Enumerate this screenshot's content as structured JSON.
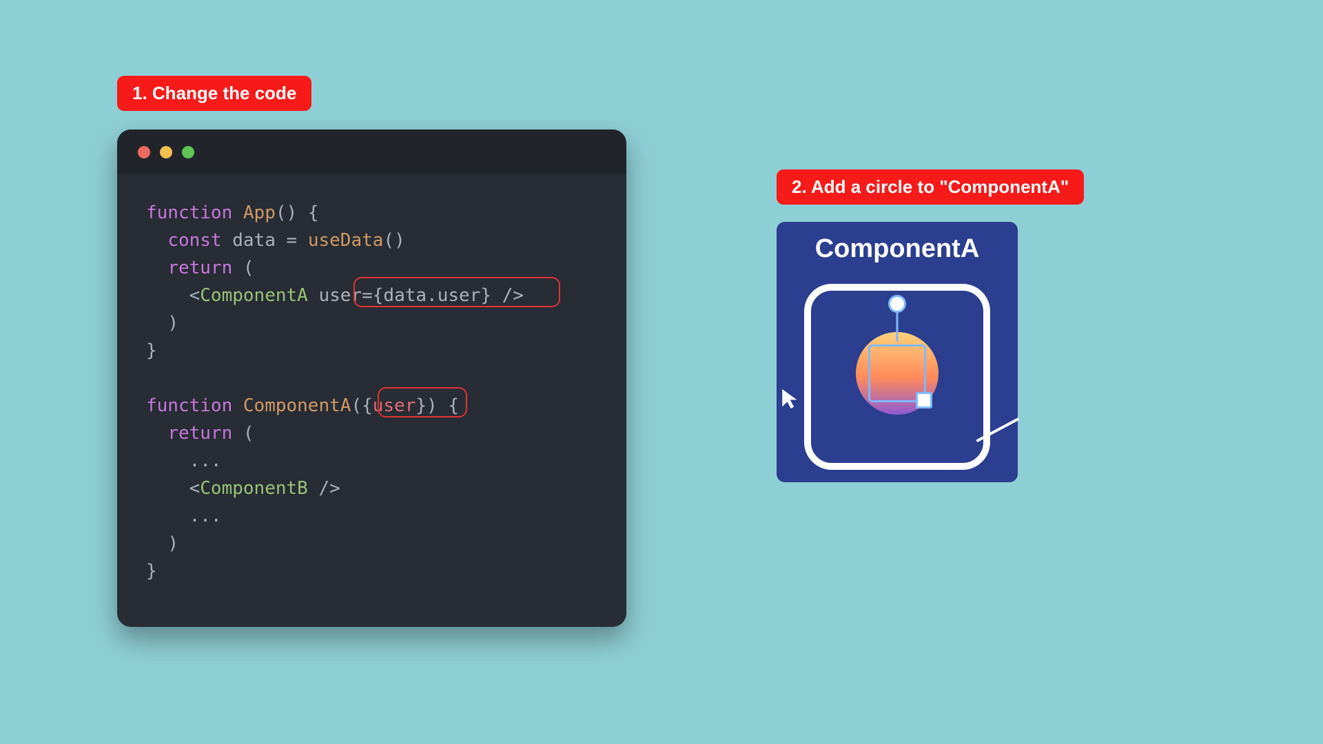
{
  "badges": {
    "step1": "1. Change the code",
    "step2": "2. Add a circle to \"ComponentA\""
  },
  "code": {
    "kw_function1": "function",
    "fn_App": "App",
    "paren_open": "() {",
    "kw_const": "const",
    "var_data": "data",
    "eq": " = ",
    "fn_useData": "useData",
    "call": "()",
    "kw_return1": "return",
    "paren1": " (",
    "open_tag1": "<",
    "tag_ComponentA": "ComponentA",
    "space": " ",
    "attr_user": "user",
    "eq2": "=",
    "lbrace": "{",
    "expr_data_user": "data.user",
    "rbrace": "}",
    "self_close": " />",
    "close_paren1": ")",
    "close_brace1": "}",
    "kw_function2": "function",
    "fn_ComponentA": "ComponentA",
    "sig_open": "(",
    "sig_lbrace": "{",
    "sig_user": "user",
    "sig_rbrace": "}",
    "sig_close": ")",
    "sig_brace": " {",
    "kw_return2": "return",
    "paren2": " (",
    "ellipsis1": "...",
    "open_tag2": "<",
    "tag_ComponentB": "ComponentB",
    "self_close2": " />",
    "ellipsis2": "...",
    "close_paren2": ")",
    "close_brace2": "}"
  },
  "component": {
    "title": "ComponentA"
  },
  "colors": {
    "page_bg": "#8ecfd6",
    "badge_bg": "#f61a19",
    "editor_bg": "#282c34",
    "comp_bg": "#2b3e8f",
    "highlight_border": "#e03434"
  }
}
